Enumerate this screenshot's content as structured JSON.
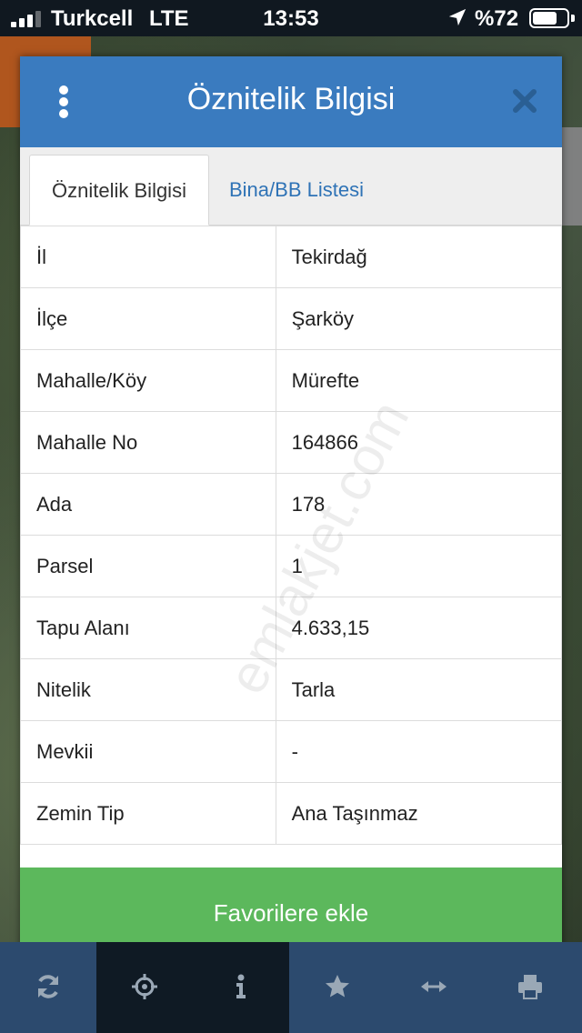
{
  "status_bar": {
    "carrier": "Turkcell",
    "network": "LTE",
    "time": "13:53",
    "battery_text": "%72",
    "battery_level": 0.72,
    "signal_bars": 3,
    "icons": [
      "signal-icon",
      "location-arrow-icon",
      "battery-icon"
    ]
  },
  "dialog": {
    "title": "Öznitelik Bilgisi",
    "tabs": [
      {
        "label": "Öznitelik Bilgisi",
        "active": true
      },
      {
        "label": "Bina/BB Listesi",
        "active": false
      }
    ],
    "rows": [
      {
        "key": "İl",
        "value": "Tekirdağ"
      },
      {
        "key": "İlçe",
        "value": "Şarköy"
      },
      {
        "key": "Mahalle/Köy",
        "value": "Mürefte"
      },
      {
        "key": "Mahalle No",
        "value": "164866"
      },
      {
        "key": "Ada",
        "value": "178"
      },
      {
        "key": "Parsel",
        "value": "1"
      },
      {
        "key": "Tapu Alanı",
        "value": "4.633,15"
      },
      {
        "key": "Nitelik",
        "value": "Tarla"
      },
      {
        "key": "Mevkii",
        "value": "-"
      },
      {
        "key": "Zemin Tip",
        "value": "Ana Taşınmaz"
      }
    ],
    "favorite_button": "Favorilere ekle"
  },
  "watermark": "emlakjet.com",
  "toolbar": {
    "tools": [
      "refresh-icon",
      "crosshair-icon",
      "info-icon",
      "star-icon",
      "measure-arrows-icon",
      "print-icon"
    ]
  },
  "colors": {
    "header": "#3a7bbf",
    "favorite_button": "#5cb85c",
    "toolbar": "#2c4a6e",
    "tab_link": "#2f73b6"
  }
}
